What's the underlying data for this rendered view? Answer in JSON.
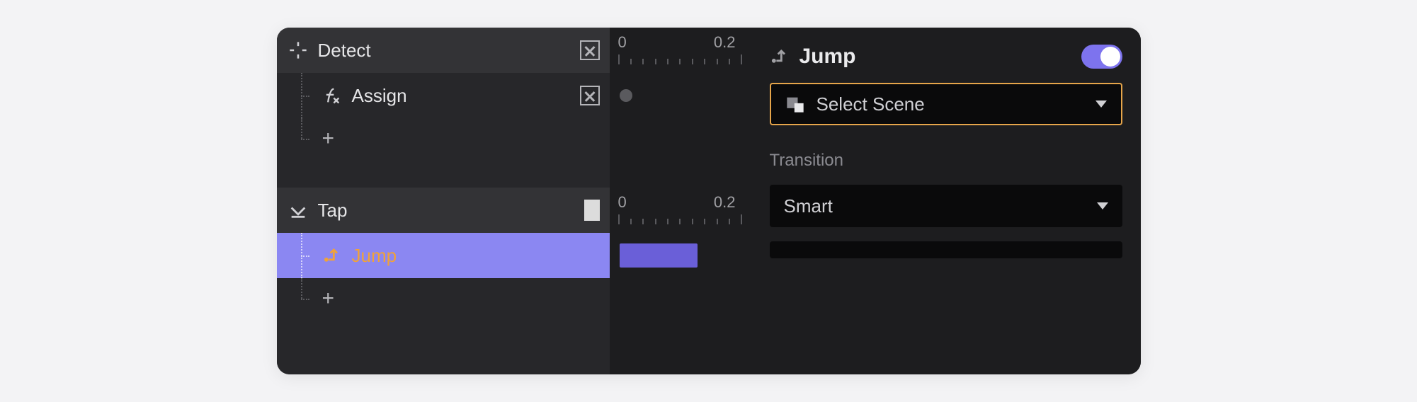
{
  "tree": {
    "group1": {
      "label": "Detect",
      "child": "Assign"
    },
    "group2": {
      "label": "Tap",
      "child": "Jump"
    },
    "add_glyph": "+"
  },
  "timeline": {
    "t0": "0",
    "t1": "0.2"
  },
  "inspector": {
    "title": "Jump",
    "scene_placeholder": "Select Scene",
    "transition_section": "Transition",
    "transition_value": "Smart"
  }
}
